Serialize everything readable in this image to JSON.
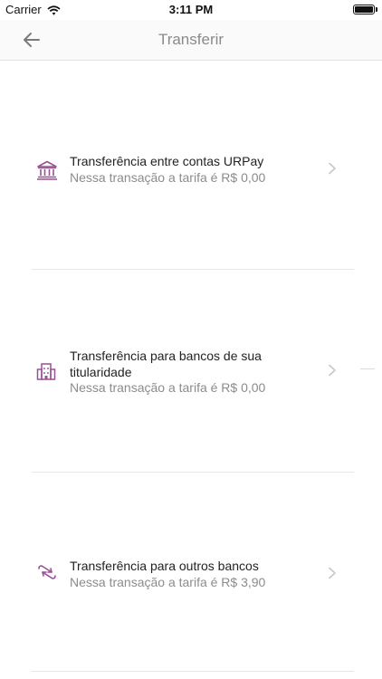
{
  "status_bar": {
    "carrier": "Carrier",
    "time": "3:11 PM"
  },
  "nav": {
    "title": "Transferir"
  },
  "options": [
    {
      "icon": "bank-icon",
      "title": "Transferência entre contas URPay",
      "subtitle": "Nessa transação a tarifa é R$ 0,00"
    },
    {
      "icon": "building-icon",
      "title": "Transferência para bancos de sua titularidade",
      "subtitle": "Nessa transação a tarifa é R$ 0,00"
    },
    {
      "icon": "transfer-arrows-icon",
      "title": "Transferência para outros bancos",
      "subtitle": "Nessa transação a tarifa é R$ 3,90"
    }
  ],
  "colors": {
    "accent": "#9b4f96",
    "chevron": "#c7c7cc"
  }
}
